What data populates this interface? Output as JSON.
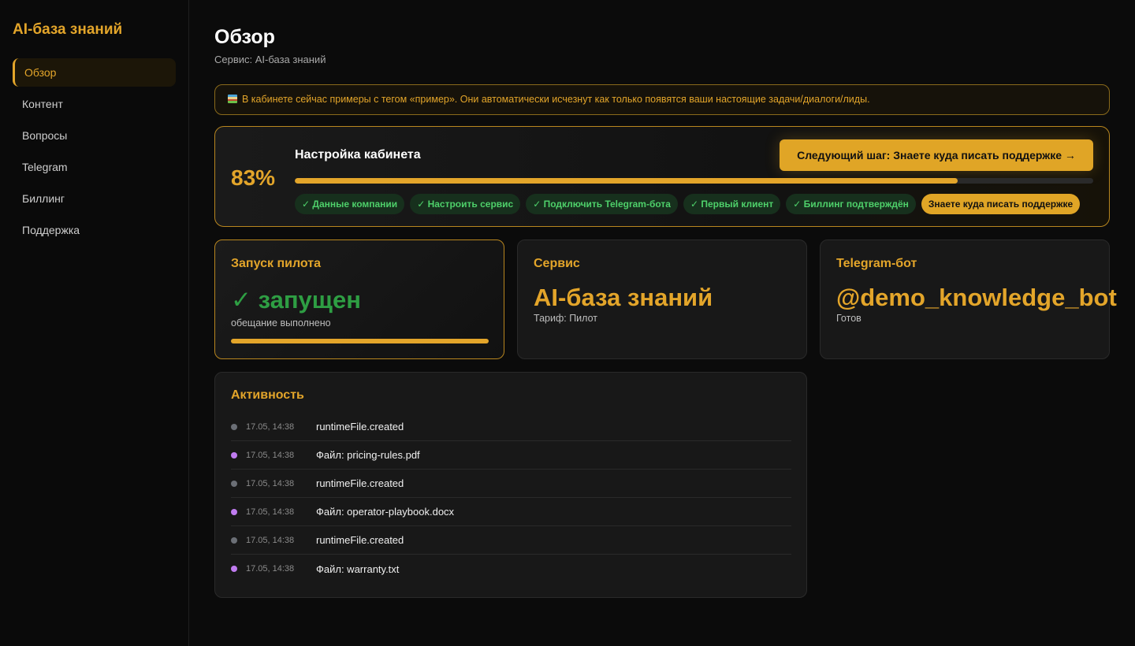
{
  "sidebar": {
    "brand": "AI-база знаний",
    "items": [
      {
        "label": "Обзор",
        "active": true
      },
      {
        "label": "Контент"
      },
      {
        "label": "Вопросы"
      },
      {
        "label": "Telegram"
      },
      {
        "label": "Биллинг"
      },
      {
        "label": "Поддержка"
      }
    ]
  },
  "header": {
    "title": "Обзор",
    "subtitle": "Сервис: AI-база знаний"
  },
  "banner": {
    "icon": "books-icon",
    "text": "В кабинете сейчас примеры с тегом «пример». Они автоматически исчезнут как только появятся ваши настоящие задачи/диалоги/лиды."
  },
  "setup": {
    "percent_label": "83%",
    "progress": 0.83,
    "title": "Настройка кабинета",
    "next_button": "Следующий шаг: Знаете куда писать поддержке →",
    "steps": [
      {
        "label": "✓ Данные компании",
        "done": true
      },
      {
        "label": "✓ Настроить сервис",
        "done": true
      },
      {
        "label": "✓ Подключить Telegram-бота",
        "done": true
      },
      {
        "label": "✓ Первый клиент",
        "done": true
      },
      {
        "label": "✓ Биллинг подтверждён",
        "done": true
      },
      {
        "label": "Знаете куда писать поддержке",
        "done": false
      }
    ]
  },
  "cards": {
    "pilot": {
      "title": "Запуск пилота",
      "value": "✓ запущен",
      "sub": "обещание выполнено",
      "progress": 1.0
    },
    "service": {
      "title": "Сервис",
      "value": "AI-база знаний",
      "sub": "Тариф: Пилот"
    },
    "telegram": {
      "title": "Telegram-бот",
      "value": "@demo_knowledge_bot",
      "sub": "Готов"
    }
  },
  "activity": {
    "title": "Активность",
    "colors": {
      "system": "#6b6f76",
      "file": "#c07cf0"
    },
    "items": [
      {
        "kind": "system",
        "time": "17.05, 14:38",
        "text": "runtimeFile.created"
      },
      {
        "kind": "file",
        "time": "17.05, 14:38",
        "text": "Файл: pricing-rules.pdf"
      },
      {
        "kind": "system",
        "time": "17.05, 14:38",
        "text": "runtimeFile.created"
      },
      {
        "kind": "file",
        "time": "17.05, 14:38",
        "text": "Файл: operator-playbook.docx"
      },
      {
        "kind": "system",
        "time": "17.05, 14:38",
        "text": "runtimeFile.created"
      },
      {
        "kind": "file",
        "time": "17.05, 14:38",
        "text": "Файл: warranty.txt"
      }
    ]
  }
}
